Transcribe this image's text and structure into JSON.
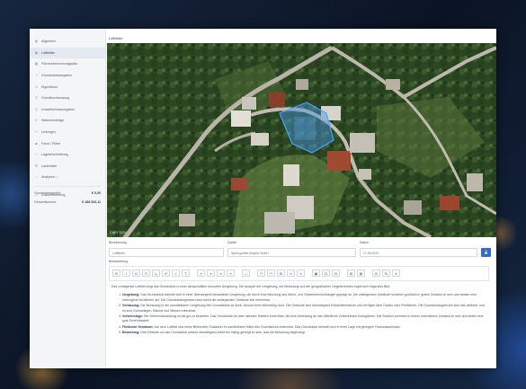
{
  "sidebar": {
    "items": [
      {
        "label": "Allgemein",
        "icon": "document-icon"
      },
      {
        "label": "Luftbilder",
        "icon": "image-icon",
        "active": true
      },
      {
        "label": "Flächenberechnungsplan",
        "icon": "grid-icon"
      },
      {
        "label": "Grundstücksangaben",
        "icon": "pin-icon"
      },
      {
        "label": "Eigentümer",
        "icon": "person-icon"
      },
      {
        "label": "Grundbuchsauszug",
        "icon": "person-icon"
      },
      {
        "label": "Umweltschutzvorgaben",
        "icon": "person-icon"
      },
      {
        "label": "Wasserverträge",
        "icon": "person-icon"
      },
      {
        "label": "Leitungen",
        "icon": "bolt-icon"
      },
      {
        "label": "Fotos / Pläne",
        "icon": "camera-icon"
      },
      {
        "label": "Lagebeschreibung",
        "icon": "location-icon"
      },
      {
        "label": "Lastenliste",
        "icon": "list-icon"
      },
      {
        "label": "Analysen / ...",
        "icon": "chart-icon"
      },
      {
        "label": "Dokumentierung",
        "icon": "folder-icon"
      }
    ],
    "totals": [
      {
        "label": "Grundstücksgröße",
        "value": "€ 0,00"
      },
      {
        "label": "Gesamtsumme",
        "value": "€ 186.526,11"
      }
    ]
  },
  "main": {
    "map_title": "Luftbilder",
    "map_copyright": "© BEV 2023",
    "form": {
      "labels": [
        "Bezeichnung",
        "Quelle",
        "Datum"
      ],
      "values": [
        "Luftbilder",
        "Sprengnetter Austria GmbH",
        "17.05.2023"
      ],
      "save_icon": "💾",
      "description_label": "Beschreibung"
    },
    "toolbar": [
      "B",
      "I",
      "U",
      "S",
      "x₂",
      "x²",
      "✓",
      "T",
      "≡",
      "≡",
      "≡",
      "≡",
      "—",
      "↶",
      "↷",
      "⊞",
      "≡",
      "≡",
      "▣",
      "⊡",
      "⊟",
      "⊞",
      "▤",
      "B",
      "B",
      "#"
    ],
    "editor": {
      "intro": "Das vorliegende Luftbild zeigt das Grundstück in einer landschaftlich reizvollen Umgebung. Die Analyse der Umgebung, der Bebauung und der geografischen Gegebenheiten ergibt sich folgendes Bild:",
      "points": [
        {
          "title": "Umgebung:",
          "text": "Das Grundstück befindet sich in einer überwiegend bewaldeten Umgebung, die durch eine Mischung aus Wohn- und Gewerbeeinrichtungen geprägt ist. Die umliegenden Gebäude scheinen großteils in gutem Zustand zu sein und weisen eine heterogene Architektur auf. Die Grundstücksgrenzen sind durch die umliegenden Gebäude klar erkennbar."
        },
        {
          "title": "Verbauung:",
          "text": "Die Bebauung in der unmittelbaren Umgebung des Grundstücks ist dicht, obwohl nicht übermäßig hoch. Die Gebäude sind überwiegend Einfamilienhäuser und verfügen über Garten oder Freiflächen. Die Grundstücksgrenzen sind klar definiert, und es sind Grünanlagen, Bäume und Wiesen erkennbar."
        },
        {
          "title": "Verkehrslage:",
          "text": "Die Verkehrsanbindung ist als gut zu bewerten. Das Grundstück ist über mehrere Straßen erreichbar, die eine Anbindung an das öffentliche Verkehrsnetz ermöglichen. Die Straßen scheinen in einem ordentlichen Zustand zu sein und bieten eine gute Erreichbarkeit."
        },
        {
          "title": "Fließende Gewässer:",
          "text": "Auf dem Luftbild sind keine fließenden Gewässer in unmittelbarer Nähe des Grundstücks erkennbar. Das Grundstück befindet sich in einer Lage mit geringem Hochwasserrisiko."
        },
        {
          "title": "Bewertung:",
          "text": "Das Gelände um das Grundstück scheint überwiegend leicht bis mäßig geneigt zu sein, was die Bebauung begünstigt."
        }
      ]
    }
  }
}
